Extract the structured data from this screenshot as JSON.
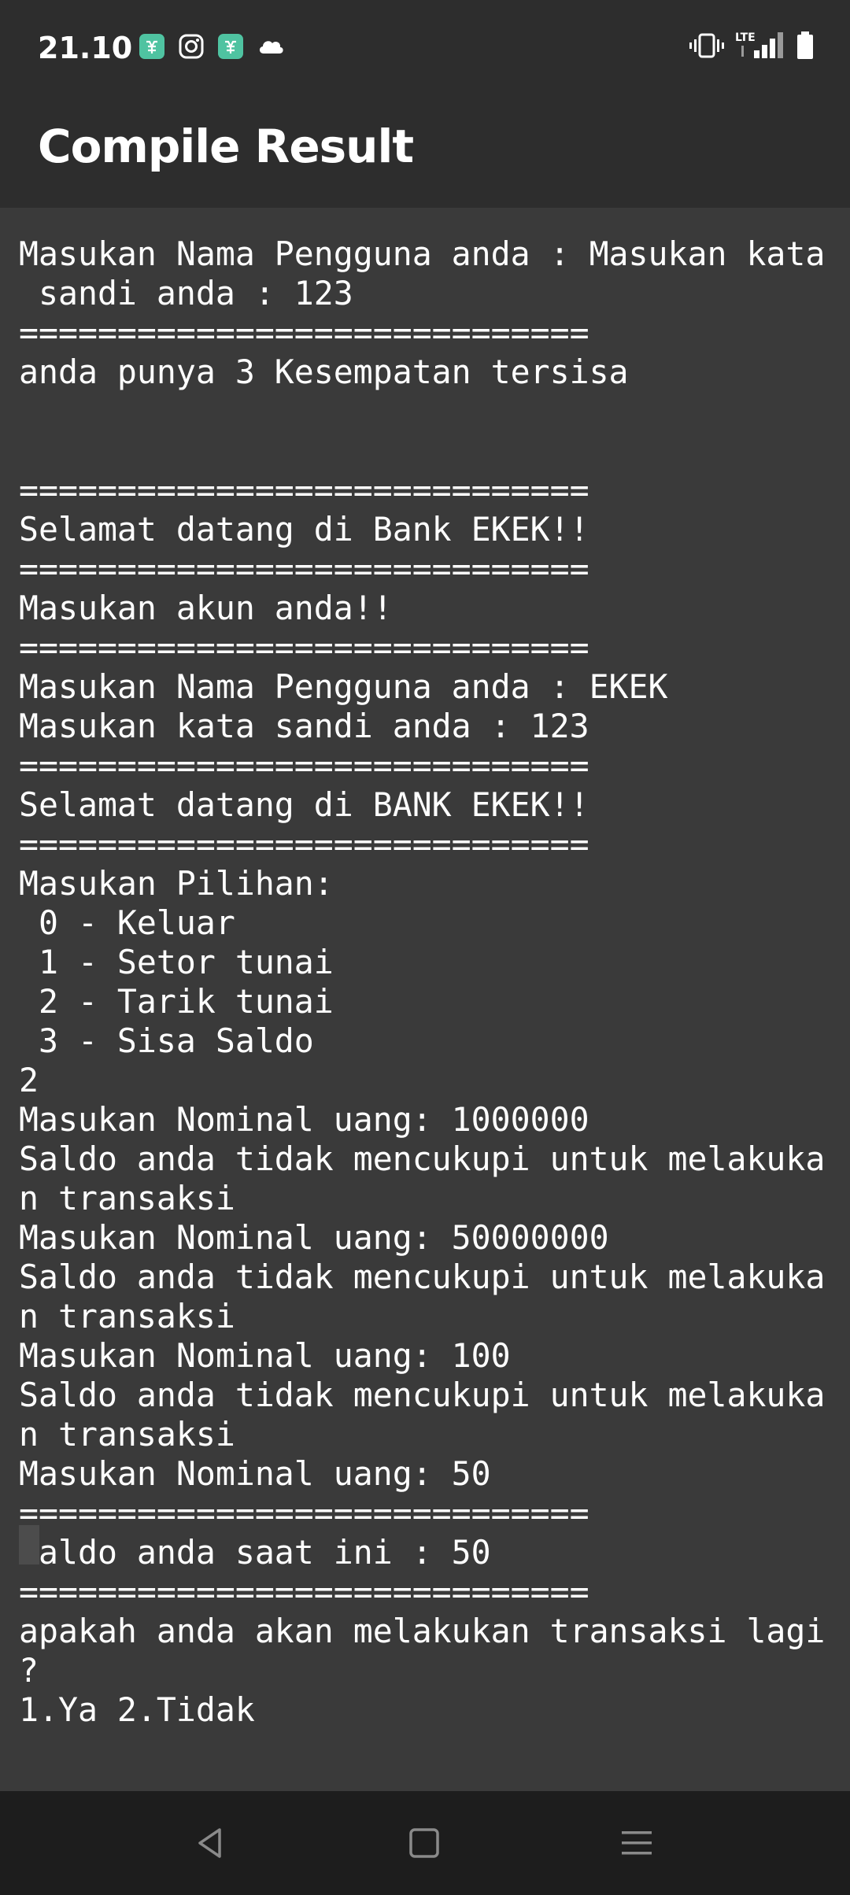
{
  "status_bar": {
    "time": "21.10",
    "network_label": "LTE",
    "notification_icons": [
      "app-icon",
      "instagram-icon",
      "app-icon",
      "cloud-icon"
    ],
    "system_icons": [
      "vibrate-icon",
      "lte-signal-icon",
      "battery-icon"
    ]
  },
  "app_bar": {
    "title": "Compile Result"
  },
  "console": {
    "lines": [
      "Masukan Nama Pengguna anda : Masukan kata",
      " sandi anda : 123",
      "=============================",
      "anda punya 3 Kesempatan tersisa",
      "",
      "",
      "=============================",
      "Selamat datang di Bank EKEK!!",
      "=============================",
      "Masukan akun anda!!",
      "=============================",
      "Masukan Nama Pengguna anda : EKEK",
      "Masukan kata sandi anda : 123",
      "=============================",
      "Selamat datang di BANK EKEK!!",
      "=============================",
      "Masukan Pilihan:",
      " 0 - Keluar",
      " 1 - Setor tunai",
      " 2 - Tarik tunai",
      " 3 - Sisa Saldo",
      "2",
      "Masukan Nominal uang: 1000000",
      "Saldo anda tidak mencukupi untuk melakuka",
      "n transaksi",
      "Masukan Nominal uang: 50000000",
      "Saldo anda tidak mencukupi untuk melakuka",
      "n transaksi",
      "Masukan Nominal uang: 100",
      "Saldo anda tidak mencukupi untuk melakuka",
      "n transaksi",
      "Masukan Nominal uang: 50",
      "=============================",
      "Saldo anda saat ini : 50",
      "=============================",
      "apakah anda akan melakukan transaksi lagi",
      "?",
      "1.Ya 2.Tidak"
    ]
  },
  "nav_bar": {
    "buttons": [
      "back-icon",
      "home-icon",
      "recents-icon"
    ]
  },
  "colors": {
    "status_bar_bg": "#2d2d2d",
    "console_bg": "#3a3a3a",
    "nav_bar_bg": "#1d1d1d",
    "text": "#ffffff",
    "notification_accent": "#4fc3a1"
  }
}
